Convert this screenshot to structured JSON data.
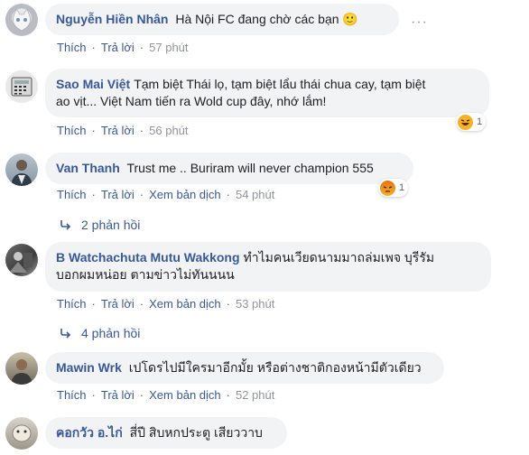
{
  "comments": [
    {
      "author": "Nguyễn Hiền Nhân",
      "text": "Hà Nội FC đang chờ các bạn 🙂",
      "actions": {
        "like": "Thích",
        "reply": "Trả lời"
      },
      "time": "57 phút",
      "more": "···"
    },
    {
      "author": "Sao Mai Việt",
      "text_line1": "Tạm biệt Thái lọ, tạm biệt lẩu thái chua cay, tạm biệt",
      "text_line2": "ao vịt... Việt Nam tiến ra Wold cup đây, nhớ lắm!",
      "actions": {
        "like": "Thích",
        "reply": "Trả lời"
      },
      "time": "56 phút",
      "reaction": {
        "type": "haha",
        "count": "1"
      }
    },
    {
      "author": "Van Thanh",
      "text": "Trust me .. Buriram will never champion 555",
      "actions": {
        "like": "Thích",
        "reply": "Trả lời",
        "translate": "Xem bản dịch"
      },
      "time": "54 phút",
      "reaction": {
        "type": "angry",
        "count": "1"
      },
      "replies": "2 phản hồi"
    },
    {
      "author": "B Watchachuta Mutu Wakkong",
      "text_line1": "ทำไมคนเวียดนามมาถล่มเพจ บุรีรัม",
      "text_line2": "บอกผมหน่อย ตามข่าวไม่ทันนนน",
      "actions": {
        "like": "Thích",
        "reply": "Trả lời",
        "translate": "Xem bản dịch"
      },
      "time": "53 phút",
      "replies": "4 phản hồi"
    },
    {
      "author": "Mawin Wrk",
      "text": "เปโดรไปมีใครมาอีกมั้ย หรือต่างชาติกองหน้ามีตัวเดียว",
      "actions": {
        "like": "Thích",
        "reply": "Trả lời",
        "translate": "Xem bản dịch"
      },
      "time": "52 phút"
    },
    {
      "author": "คอกวัว อ.ไก่",
      "text": "สี่ปี สิบหกประตู เสียววาบ"
    }
  ],
  "colors": {
    "link": "#385898",
    "bubble": "#f2f3f5",
    "meta": "#606770"
  }
}
